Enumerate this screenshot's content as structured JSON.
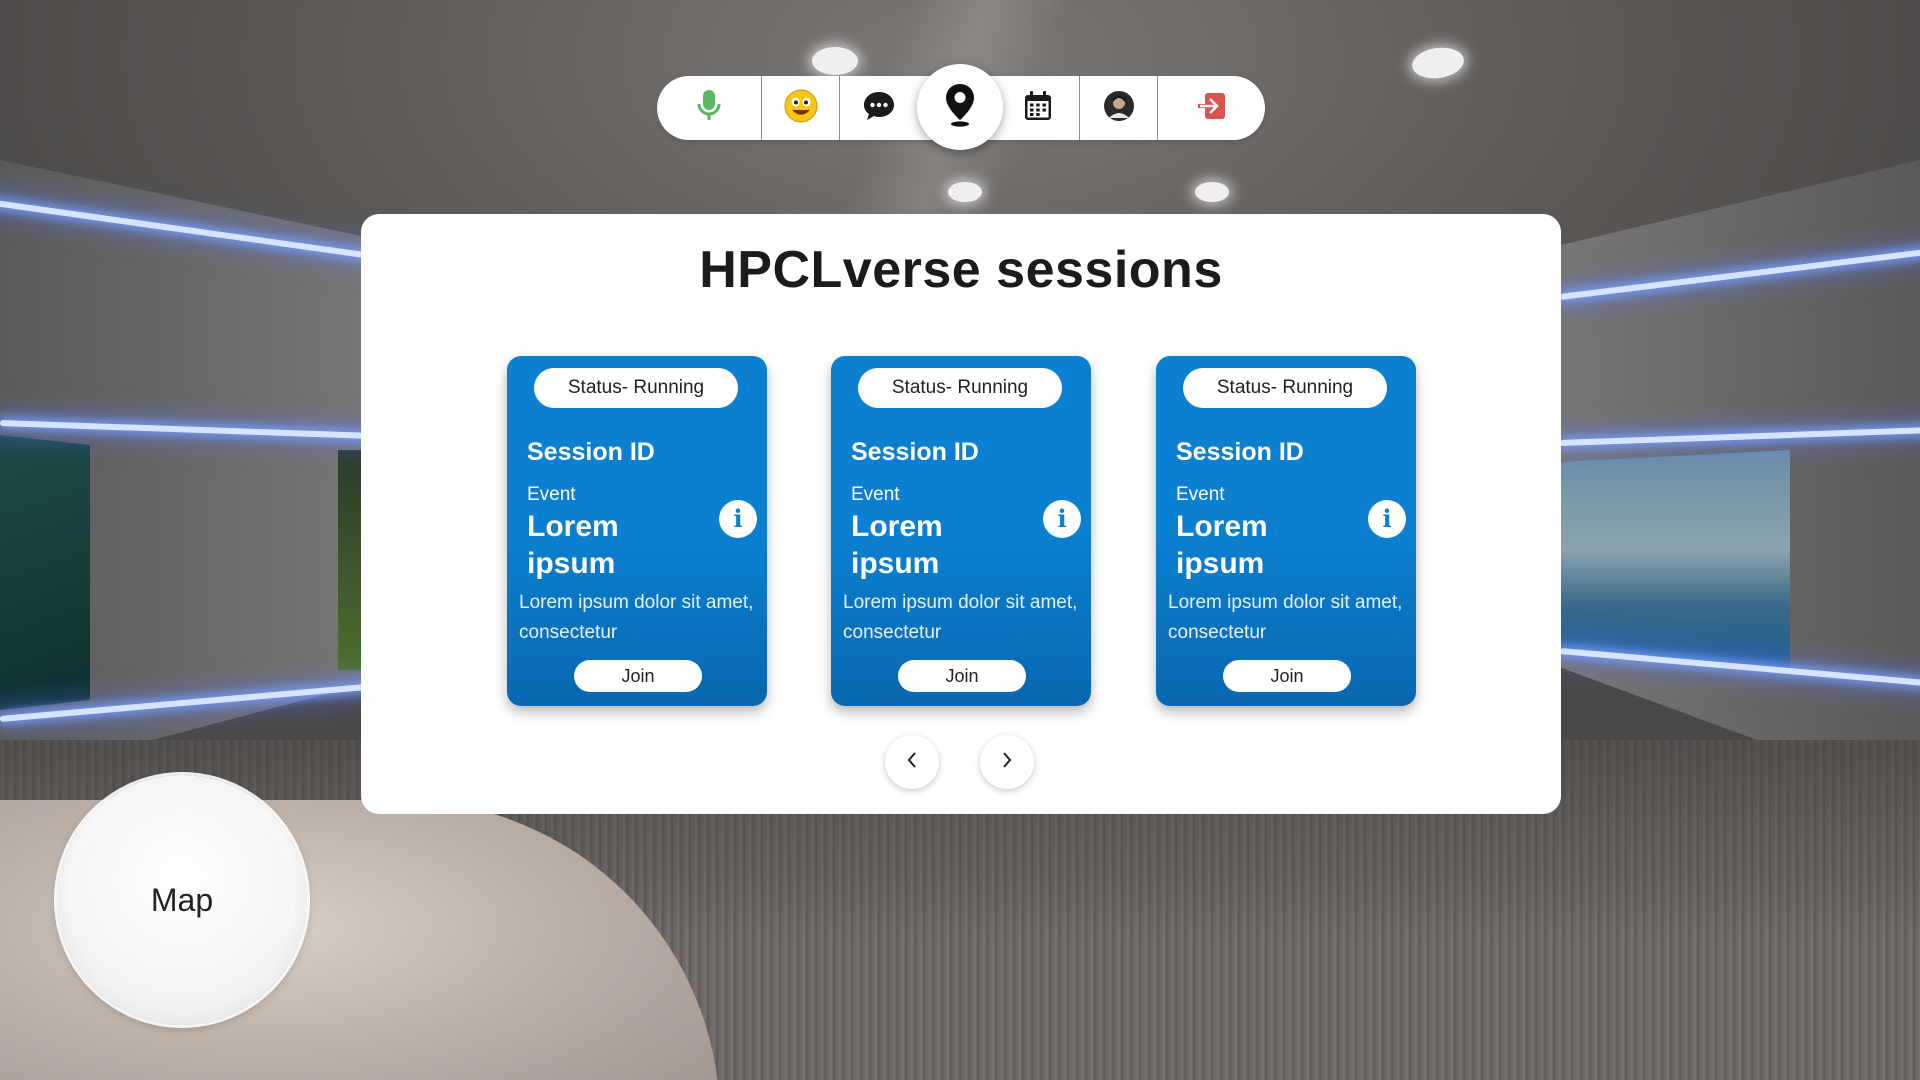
{
  "toolbar": {
    "items": [
      {
        "icon": "microphone-icon",
        "color": "#5cb85c"
      },
      {
        "icon": "emoji-icon",
        "color": "#f5c518"
      },
      {
        "icon": "chat-icon",
        "color": "#1b1b1b"
      },
      {
        "icon": "location-pin-icon",
        "color": "#1b1b1b",
        "active": true
      },
      {
        "icon": "calendar-icon",
        "color": "#1b1b1b"
      },
      {
        "icon": "avatar-icon",
        "color": "#1b1b1b"
      },
      {
        "icon": "exit-icon",
        "color": "#d9534f"
      }
    ]
  },
  "panel": {
    "title": "HPCLverse sessions",
    "sessions": [
      {
        "status": "Status- Running",
        "session_id": "Session ID",
        "event_label": "Event",
        "event_name": "Lorem ipsum",
        "description": "Lorem ipsum dolor sit amet, consectetur",
        "join_label": "Join",
        "info_glyph": "i"
      },
      {
        "status": "Status- Running",
        "session_id": "Session ID",
        "event_label": "Event",
        "event_name": "Lorem ipsum",
        "description": "Lorem ipsum dolor sit amet, consectetur",
        "join_label": "Join",
        "info_glyph": "i"
      },
      {
        "status": "Status- Running",
        "session_id": "Session ID",
        "event_label": "Event",
        "event_name": "Lorem ipsum",
        "description": "Lorem ipsum dolor sit amet, consectetur",
        "join_label": "Join",
        "info_glyph": "i"
      }
    ],
    "prev_icon": "chevron-left-icon",
    "next_icon": "chevron-right-icon"
  },
  "map": {
    "label": "Map"
  },
  "colors": {
    "card_blue": "#0b7fd0",
    "card_blue_dark": "#0967b0",
    "panel_bg": "#ffffff",
    "mic_green": "#5cb85c",
    "exit_red": "#d9534f"
  }
}
